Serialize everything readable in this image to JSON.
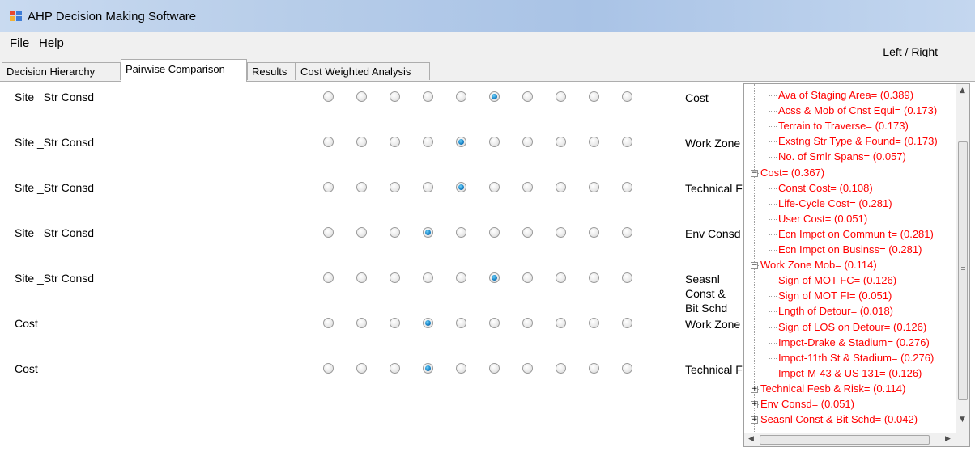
{
  "window": {
    "title": "AHP Decision Making Software",
    "colors": {
      "titlebar": "#b7cde9",
      "selected_radio": "#1b86c9",
      "tree_text": "#ff0000"
    }
  },
  "menu": {
    "items": [
      "File",
      "Help"
    ],
    "toggle_label": "Left / Right"
  },
  "tabs": [
    {
      "label": "Decision Hierarchy",
      "active": false
    },
    {
      "label": "Pairwise Comparison",
      "active": true
    },
    {
      "label": "Results",
      "active": false
    },
    {
      "label": "Cost Weighted Analysis",
      "active": false
    }
  ],
  "comparisons": [
    {
      "left": "Site _Str Consd",
      "right": "Cost",
      "selected_index": 5
    },
    {
      "left": "Site _Str Consd",
      "right": "Work Zone Mob",
      "selected_index": 4
    },
    {
      "left": "Site _Str Consd",
      "right": "Technical Fesb & Risk",
      "selected_index": 4
    },
    {
      "left": "Site _Str Consd",
      "right": "Env Consd",
      "selected_index": 3
    },
    {
      "left": "Site _Str Consd",
      "right": "Seasnl Const & Bit Schd",
      "selected_index": 5
    },
    {
      "left": "Cost",
      "right": "Work Zone Mob",
      "selected_index": 3
    },
    {
      "left": "Cost",
      "right": "Technical Fesb & Risk",
      "selected_index": 3
    }
  ],
  "tree": {
    "nodes": [
      {
        "text": "Ava of Staging Area=  (0.389)",
        "level": "child"
      },
      {
        "text": "Acss & Mob of Cnst Equi=  (0.173)",
        "level": "child"
      },
      {
        "text": "Terrain to Traverse=  (0.173)",
        "level": "child"
      },
      {
        "text": "Exstng Str Type & Found=  (0.173)",
        "level": "child"
      },
      {
        "text": "No. of Smlr Spans=  (0.057)",
        "level": "child"
      },
      {
        "text": "Cost=  (0.367)",
        "level": "parent",
        "expander": "−"
      },
      {
        "text": "Const Cost=  (0.108)",
        "level": "child"
      },
      {
        "text": "Life-Cycle Cost=  (0.281)",
        "level": "child"
      },
      {
        "text": "User Cost=  (0.051)",
        "level": "child"
      },
      {
        "text": "Ecn Impct on Commun t=  (0.281)",
        "level": "child"
      },
      {
        "text": "Ecn Impct on Businss=  (0.281)",
        "level": "child"
      },
      {
        "text": "Work Zone Mob=  (0.114)",
        "level": "parent",
        "expander": "−"
      },
      {
        "text": "Sign of MOT FC=  (0.126)",
        "level": "child"
      },
      {
        "text": "Sign of MOT FI=  (0.051)",
        "level": "child"
      },
      {
        "text": "Lngth of Detour=  (0.018)",
        "level": "child"
      },
      {
        "text": "Sign of LOS on Detour=  (0.126)",
        "level": "child"
      },
      {
        "text": "Impct-Drake & Stadium=  (0.276)",
        "level": "child"
      },
      {
        "text": "Impct-11th St & Stadium=  (0.276)",
        "level": "child"
      },
      {
        "text": "Impct-M-43 & US 131=  (0.126)",
        "level": "child"
      },
      {
        "text": "Technical Fesb & Risk=  (0.114)",
        "level": "parent",
        "expander": "+"
      },
      {
        "text": "Env Consd=  (0.051)",
        "level": "parent",
        "expander": "+"
      },
      {
        "text": "Seasnl Const & Bit Schd=  (0.042)",
        "level": "parent",
        "expander": "+"
      }
    ]
  }
}
